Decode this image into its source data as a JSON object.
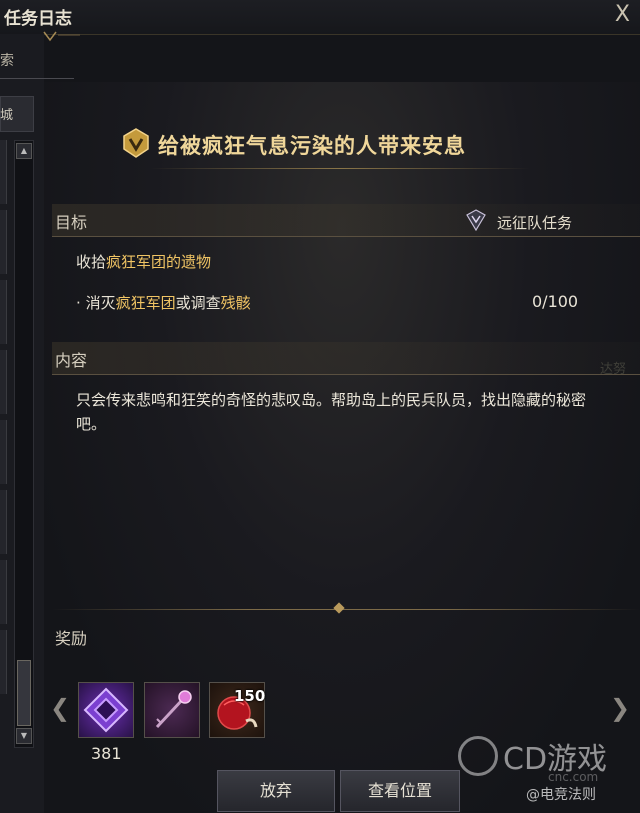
{
  "window": {
    "title": "任务日志",
    "close_glyph": "X"
  },
  "sidebar": {
    "tab_label": "索",
    "filter_label": "城"
  },
  "quest": {
    "title": "给被疯狂气息污染的人带来安息",
    "objective_label": "目标",
    "quest_type": "远征队任务",
    "main_objective": {
      "pre": "收拾",
      "highlight": "疯狂军团的遗物"
    },
    "sub_objective": {
      "bullet": "·",
      "pre": "消灭",
      "hl1": "疯狂军团",
      "mid": "或调查",
      "hl2": "残骸",
      "count": "0/100"
    },
    "content_label": "内容",
    "description": "只会传来悲鸣和狂笑的奇怪的悲叹岛。帮助岛上的民兵队员，找出隐藏的秘密吧。"
  },
  "rewards": {
    "label": "奖励",
    "items": [
      {
        "icon": "purple-gem-icon",
        "quantity": "381"
      },
      {
        "icon": "key-staff-icon",
        "quantity": ""
      },
      {
        "icon": "red-fruit-icon",
        "quantity": "150"
      }
    ]
  },
  "buttons": {
    "abandon": "放弃",
    "view_location": "查看位置"
  },
  "background_text": {
    "top_right": "达努"
  },
  "watermark": {
    "logo": "CD游戏",
    "site": "cnc.com",
    "credit": "@电竞法则"
  },
  "colors": {
    "accent_gold": "#f0c464",
    "title_gold": "#f0d79a",
    "background": "#141519"
  }
}
